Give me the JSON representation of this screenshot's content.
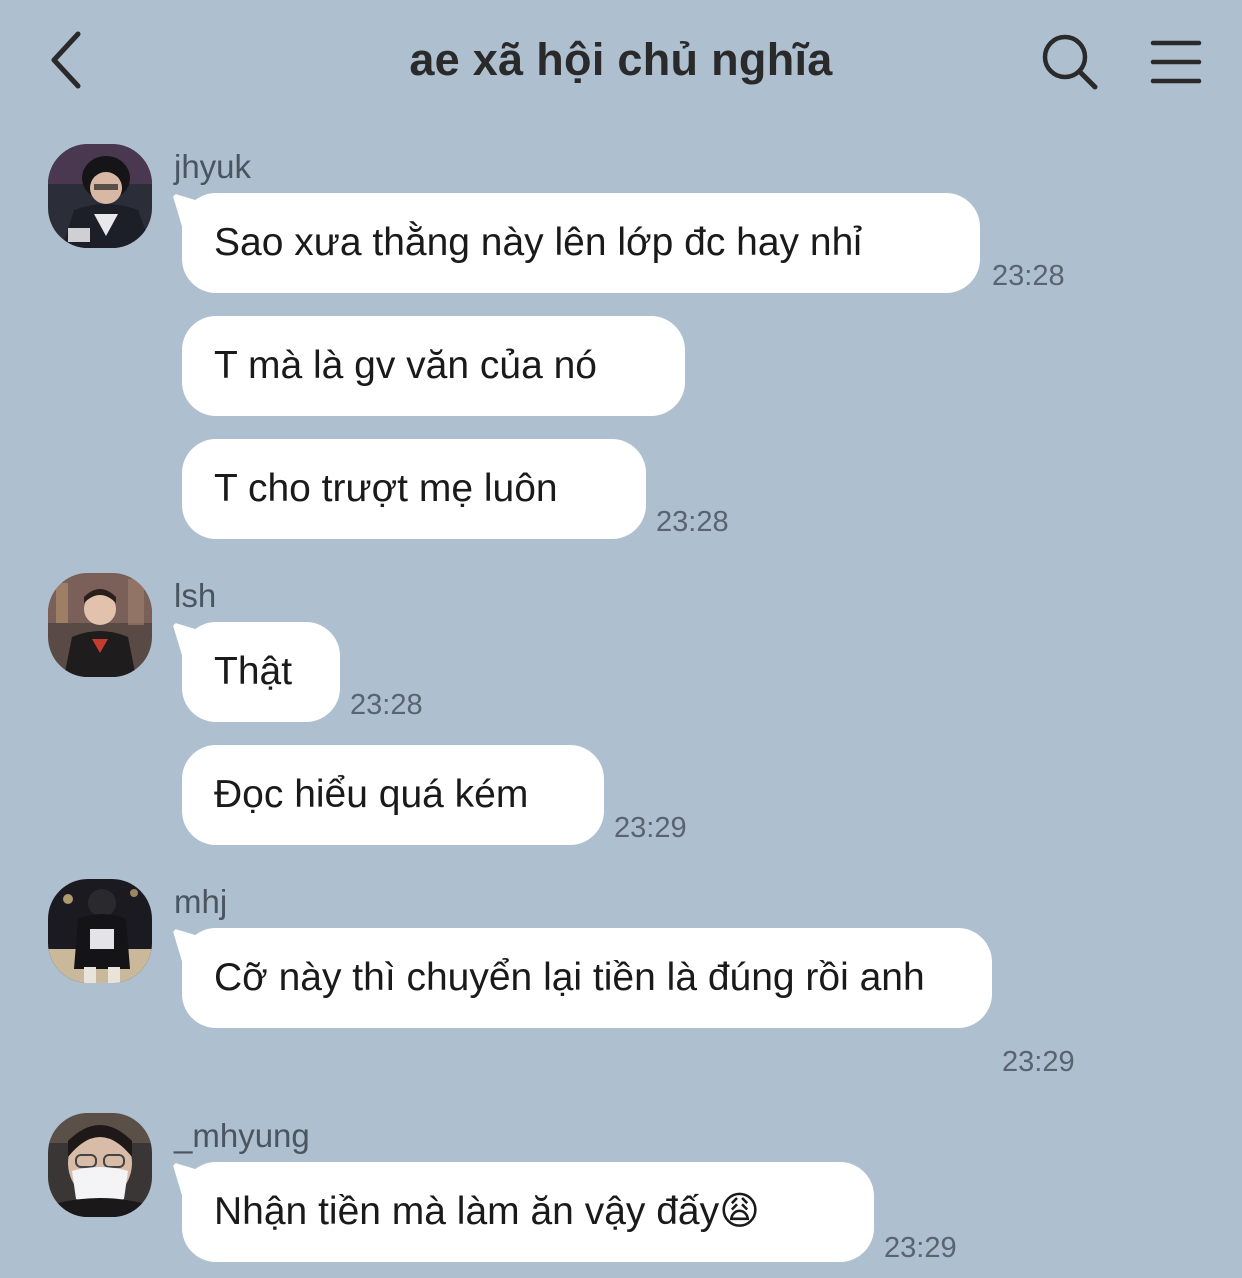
{
  "header": {
    "title": "ae xã hội chủ nghĩa",
    "back_icon": "chevron-left-icon",
    "search_icon": "search-icon",
    "menu_icon": "hamburger-menu-icon"
  },
  "messages": [
    {
      "sender": "jhyuk",
      "text": "Sao xưa thằng này lên lớp đc hay nhỉ",
      "time": "23:28"
    },
    {
      "text": "T mà là gv văn của nó",
      "time": ""
    },
    {
      "text": "T cho trượt mẹ luôn",
      "time": "23:28"
    },
    {
      "sender": "lsh",
      "text": "Thật",
      "time": "23:28"
    },
    {
      "text": "Đọc hiểu quá kém",
      "time": "23:29"
    },
    {
      "sender": "mhj",
      "text": "Cỡ này thì chuyển lại tiền là đúng rồi anh",
      "time": "23:29"
    },
    {
      "sender": "_mhyung",
      "text": "Nhận tiền mà làm ăn vậy đấy😩",
      "time": "23:29"
    }
  ],
  "colors": {
    "background": "#aebfd0",
    "bubble": "#ffffff"
  }
}
